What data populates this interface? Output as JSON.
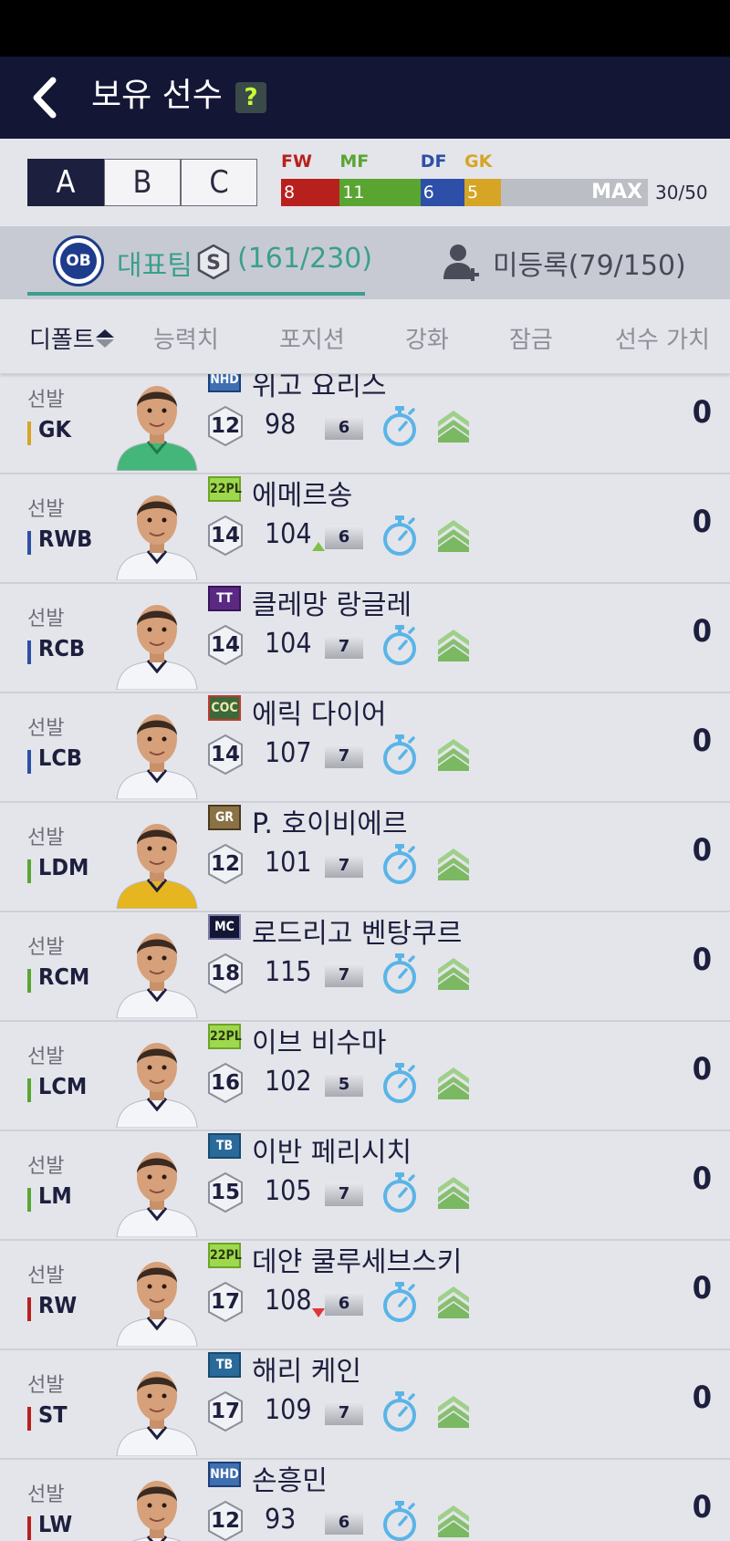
{
  "header": {
    "title": "보유 선수",
    "help_label": "?"
  },
  "squads": {
    "items": [
      "A",
      "B",
      "C"
    ],
    "active": 0
  },
  "capacity": {
    "labels": [
      {
        "name": "FW",
        "color": "#b8201e"
      },
      {
        "name": "MF",
        "color": "#5aa532"
      },
      {
        "name": "DF",
        "color": "#2d4fa8"
      },
      {
        "name": "GK",
        "color": "#d6a526"
      }
    ],
    "segments": [
      {
        "pos": "FW",
        "count": "8",
        "value": 8,
        "color": "#b8201e"
      },
      {
        "pos": "MF",
        "count": "11",
        "value": 11,
        "color": "#5aa532"
      },
      {
        "pos": "DF",
        "count": "6",
        "value": 6,
        "color": "#2d4fa8"
      },
      {
        "pos": "GK",
        "count": "5",
        "value": 5,
        "color": "#d6a526"
      }
    ],
    "max_label": "MAX",
    "count": "30/50",
    "limit": 50
  },
  "tabs": {
    "team_logo": "OB",
    "team_label": "대표팀",
    "team_count": "(161/230)",
    "unregistered_label": "미등록(79/150)",
    "accent": "#3a9f8d"
  },
  "sort": {
    "default": "디폴트",
    "ability": "능력치",
    "position": "포지션",
    "enhance": "강화",
    "lock": "잠금",
    "player_value": "선수 가치"
  },
  "players": [
    {
      "status": "선발",
      "pos": "GK",
      "pos_color": "#d6a526",
      "season": "NHD",
      "season_style": "nhd",
      "name": "위고 요리스",
      "ovr": "12",
      "rating": "98",
      "change": "none",
      "level": "6",
      "value": "0",
      "kit": "gk"
    },
    {
      "status": "선발",
      "pos": "RWB",
      "pos_color": "#2d4fa8",
      "season": "22PL",
      "season_style": "pl",
      "name": "에메르송",
      "ovr": "14",
      "rating": "104",
      "change": "up",
      "level": "6",
      "value": "0",
      "kit": "white"
    },
    {
      "status": "선발",
      "pos": "RCB",
      "pos_color": "#2d4fa8",
      "season": "TT",
      "season_style": "tt",
      "name": "클레망 랑글레",
      "ovr": "14",
      "rating": "104",
      "change": "none",
      "level": "7",
      "value": "0",
      "kit": "white"
    },
    {
      "status": "선발",
      "pos": "LCB",
      "pos_color": "#2d4fa8",
      "season": "COC",
      "season_style": "coc",
      "name": "에릭 다이어",
      "ovr": "14",
      "rating": "107",
      "change": "none",
      "level": "7",
      "value": "0",
      "kit": "white"
    },
    {
      "status": "선발",
      "pos": "LDM",
      "pos_color": "#5aa532",
      "season": "GR",
      "season_style": "gr",
      "name": "P. 호이비에르",
      "ovr": "12",
      "rating": "101",
      "change": "none",
      "level": "7",
      "value": "0",
      "kit": "yellow"
    },
    {
      "status": "선발",
      "pos": "RCM",
      "pos_color": "#5aa532",
      "season": "MC",
      "season_style": "mc",
      "name": "로드리고 벤탕쿠르",
      "ovr": "18",
      "rating": "115",
      "change": "none",
      "level": "7",
      "value": "0",
      "kit": "white"
    },
    {
      "status": "선발",
      "pos": "LCM",
      "pos_color": "#5aa532",
      "season": "22PL",
      "season_style": "pl",
      "name": "이브 비수마",
      "ovr": "16",
      "rating": "102",
      "change": "none",
      "level": "5",
      "value": "0",
      "kit": "white"
    },
    {
      "status": "선발",
      "pos": "LM",
      "pos_color": "#5aa532",
      "season": "TB",
      "season_style": "tb",
      "name": "이반 페리시치",
      "ovr": "15",
      "rating": "105",
      "change": "none",
      "level": "7",
      "value": "0",
      "kit": "white"
    },
    {
      "status": "선발",
      "pos": "RW",
      "pos_color": "#b8201e",
      "season": "22PL",
      "season_style": "pl",
      "name": "데얀 쿨루세브스키",
      "ovr": "17",
      "rating": "108",
      "change": "down",
      "level": "6",
      "value": "0",
      "kit": "white"
    },
    {
      "status": "선발",
      "pos": "ST",
      "pos_color": "#b8201e",
      "season": "TB",
      "season_style": "tb",
      "name": "해리 케인",
      "ovr": "17",
      "rating": "109",
      "change": "none",
      "level": "7",
      "value": "0",
      "kit": "white"
    },
    {
      "status": "선발",
      "pos": "LW",
      "pos_color": "#b8201e",
      "season": "NHD",
      "season_style": "nhd",
      "name": "손흥민",
      "ovr": "12",
      "rating": "93",
      "change": "none",
      "level": "6",
      "value": "0",
      "kit": "white"
    }
  ]
}
